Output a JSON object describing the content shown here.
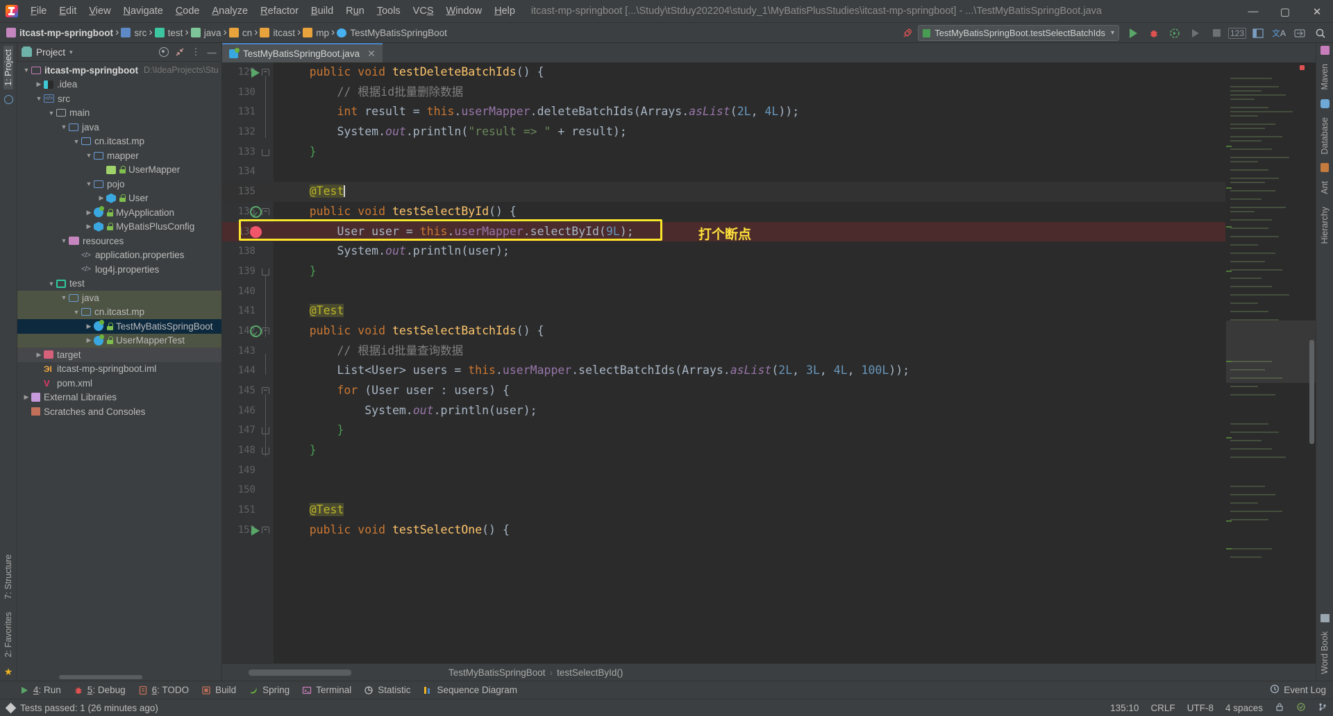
{
  "window": {
    "title": "itcast-mp-springboot [...\\Study\\tStduy202204\\study_1\\MyBatisPlusStudies\\itcast-mp-springboot] - ...\\TestMyBatisSpringBoot.java",
    "minimize": "—",
    "maximize": "▢",
    "close": "✕"
  },
  "menu": [
    {
      "label": "File"
    },
    {
      "label": "Edit"
    },
    {
      "label": "View"
    },
    {
      "label": "Navigate"
    },
    {
      "label": "Code"
    },
    {
      "label": "Analyze"
    },
    {
      "label": "Refactor"
    },
    {
      "label": "Build"
    },
    {
      "label": "Run"
    },
    {
      "label": "Tools"
    },
    {
      "label": "VCS"
    },
    {
      "label": "Window"
    },
    {
      "label": "Help"
    }
  ],
  "breadcrumb": [
    {
      "label": "itcast-mp-springboot",
      "icon": "module-icon"
    },
    {
      "label": "src",
      "icon": "source-root-icon"
    },
    {
      "label": "test",
      "icon": "test-root-icon"
    },
    {
      "label": "java",
      "icon": "folder-icon"
    },
    {
      "label": "cn",
      "icon": "package-icon"
    },
    {
      "label": "itcast",
      "icon": "package-icon"
    },
    {
      "label": "mp",
      "icon": "package-icon"
    },
    {
      "label": "TestMyBatisSpringBoot",
      "icon": "class-icon"
    }
  ],
  "run_config": {
    "label": "TestMyBatisSpringBoot.testSelectBatchIds",
    "dropdown": "▾"
  },
  "toolbar_right": {
    "run": "run-icon",
    "debug": "debug-icon",
    "run_coverage": "run-with-coverage-icon",
    "profile": "profile-icon",
    "stop": "stop-icon",
    "number": "123",
    "layout": "layout-icon",
    "translate": "translate-icon",
    "updates": "updates-icon",
    "search": "search-icon"
  },
  "left_rail": {
    "top": [
      "1: Project"
    ],
    "bottom": [
      "7: Structure",
      "2: Favorites"
    ]
  },
  "right_rail": {
    "top": [
      "Maven",
      "Database",
      "Ant",
      "Hierarchy"
    ],
    "bottom": [
      "Word Book"
    ]
  },
  "project_panel": {
    "title": "Project",
    "chevron": "▾",
    "actions": [
      "locate-icon",
      "collapse-all-icon",
      "options-icon",
      "hide-icon"
    ],
    "tree": [
      {
        "indent": 0,
        "arrow": "▼",
        "icon": "module-icon",
        "label": "itcast-mp-springboot",
        "bold": true,
        "path": "D:\\IdeaProjects\\Stu",
        "state": "normal"
      },
      {
        "indent": 1,
        "arrow": "▶",
        "icon": "idea-folder-icon",
        "label": ".idea",
        "state": "normal"
      },
      {
        "indent": 1,
        "arrow": "▼",
        "icon": "source-root-icon",
        "label": "src",
        "state": "normal"
      },
      {
        "indent": 2,
        "arrow": "▼",
        "icon": "folder-icon",
        "label": "main",
        "state": "normal"
      },
      {
        "indent": 3,
        "arrow": "▼",
        "icon": "folder-blue-icon",
        "label": "java",
        "state": "normal"
      },
      {
        "indent": 4,
        "arrow": "▼",
        "icon": "folder-blue-icon",
        "label": "cn.itcast.mp",
        "state": "normal"
      },
      {
        "indent": 5,
        "arrow": "▼",
        "icon": "folder-blue-icon",
        "label": "mapper",
        "state": "normal"
      },
      {
        "indent": 6,
        "arrow": "",
        "icon": "mapper-interface-icon",
        "label": "UserMapper",
        "lock": true,
        "state": "normal"
      },
      {
        "indent": 5,
        "arrow": "▼",
        "icon": "folder-blue-icon",
        "label": "pojo",
        "state": "normal"
      },
      {
        "indent": 6,
        "arrow": "▶",
        "icon": "class-icon",
        "label": "User",
        "lock": true,
        "state": "normal"
      },
      {
        "indent": 5,
        "arrow": "▶",
        "icon": "spring-class-icon",
        "label": "MyApplication",
        "lock": true,
        "state": "normal"
      },
      {
        "indent": 5,
        "arrow": "▶",
        "icon": "class-icon",
        "label": "MyBatisPlusConfig",
        "lock": true,
        "state": "normal"
      },
      {
        "indent": 3,
        "arrow": "▼",
        "icon": "resource-root-icon",
        "label": "resources",
        "state": "normal"
      },
      {
        "indent": 4,
        "arrow": "",
        "icon": "properties-icon",
        "label": "application.properties",
        "state": "normal"
      },
      {
        "indent": 4,
        "arrow": "",
        "icon": "properties-icon",
        "label": "log4j.properties",
        "state": "normal"
      },
      {
        "indent": 2,
        "arrow": "▼",
        "icon": "test-root-icon",
        "label": "test",
        "state": "normal"
      },
      {
        "indent": 3,
        "arrow": "▼",
        "icon": "folder-blue-icon",
        "label": "java",
        "state": "green"
      },
      {
        "indent": 4,
        "arrow": "▼",
        "icon": "folder-blue-icon",
        "label": "cn.itcast.mp",
        "state": "green"
      },
      {
        "indent": 5,
        "arrow": "▶",
        "icon": "spring-class-icon",
        "label": "TestMyBatisSpringBoot",
        "lock": true,
        "state": "selected"
      },
      {
        "indent": 5,
        "arrow": "▶",
        "icon": "spring-class-icon",
        "label": "UserMapperTest",
        "lock": true,
        "state": "green"
      },
      {
        "indent": 1,
        "arrow": "▶",
        "icon": "excluded-folder-icon",
        "label": "target",
        "state": "gray"
      },
      {
        "indent": 1,
        "arrow": "",
        "icon": "iml-icon",
        "label": "itcast-mp-springboot.iml",
        "state": "normal"
      },
      {
        "indent": 1,
        "arrow": "",
        "icon": "maven-icon",
        "label": "pom.xml",
        "state": "normal"
      },
      {
        "indent": 0,
        "arrow": "▶",
        "icon": "library-icon",
        "label": "External Libraries",
        "state": "normal"
      },
      {
        "indent": 0,
        "arrow": "",
        "icon": "scratches-icon",
        "label": "Scratches and Consoles",
        "state": "normal"
      }
    ]
  },
  "editor": {
    "tab": {
      "label": "TestMyBatisSpringBoot.java",
      "close": "✕",
      "icon": "java-spring-class-icon"
    },
    "first_line_number": 129,
    "lines": [
      {
        "n": 129,
        "marker": "run",
        "fold": "top",
        "html": "    <span class='kw'>public</span> <span class='kw'>void</span> <span class='fn'>testDeleteBatchIds</span><span class='brace'>()</span> <span class='brace'>{</span>",
        "text": "    public void testDeleteBatchIds() {"
      },
      {
        "n": 130,
        "marker": "",
        "fold": "",
        "html": "        <span class='cmt'>// 根据id批量删除数据</span>",
        "text": "        // 根据id批量删除数据"
      },
      {
        "n": 131,
        "marker": "",
        "fold": "",
        "html": "        <span class='kw'>int</span> result = <span class='kw'>this</span>.<span class='fld'>userMapper</span>.deleteBatchIds<span class='brace'>(</span>Arrays.<span class='fld'><i>asList</i></span><span class='brace'>(</span><span class='num'>2L</span>, <span class='num'>4L</span><span class='brace'>))</span>;",
        "text": "        int result = this.userMapper.deleteBatchIds(Arrays.asList(2L, 4L));"
      },
      {
        "n": 132,
        "marker": "",
        "fold": "",
        "html": "        System.<span class='fld'><i>out</i></span>.println<span class='brace'>(</span><span class='str'>\"result =&gt; \"</span> + result<span class='brace'>)</span>;",
        "text": "        System.out.println(\"result => \" + result);"
      },
      {
        "n": 133,
        "marker": "",
        "fold": "bot",
        "html": "    <span class='green-b'>}</span>",
        "text": "    }"
      },
      {
        "n": 134,
        "marker": "",
        "fold": "",
        "html": "",
        "text": ""
      },
      {
        "n": 135,
        "marker": "",
        "fold": "",
        "current": true,
        "html": "    <span class='ann ann-hl'>@Test</span><span class='caret'></span>",
        "text": "    @Test"
      },
      {
        "n": 136,
        "marker": "test-ok",
        "fold": "top",
        "html": "    <span class='kw'>public</span> <span class='kw'>void</span> <span class='fn'>testSelectById</span><span class='brace'>()</span> <span class='brace'>{</span>",
        "text": "    public void testSelectById() {"
      },
      {
        "n": 137,
        "marker": "breakpoint",
        "fold": "",
        "breakpoint": true,
        "html": "        User user = <span class='kw'>this</span>.<span class='fld'>userMapper</span>.selectById<span class='brace'>(</span><span class='num'>9L</span><span class='brace'>)</span>;",
        "text": "        User user = this.userMapper.selectById(9L);"
      },
      {
        "n": 138,
        "marker": "",
        "fold": "",
        "html": "        System.<span class='fld'><i>out</i></span>.println<span class='brace'>(</span>user<span class='brace'>)</span>;",
        "text": "        System.out.println(user);"
      },
      {
        "n": 139,
        "marker": "",
        "fold": "bot",
        "html": "    <span class='green-b'>}</span>",
        "text": "    }"
      },
      {
        "n": 140,
        "marker": "",
        "fold": "",
        "html": "",
        "text": ""
      },
      {
        "n": 141,
        "marker": "",
        "fold": "",
        "html": "    <span class='ann ann-hl'>@Test</span>",
        "text": "    @Test"
      },
      {
        "n": 142,
        "marker": "test-ok",
        "fold": "top",
        "html": "    <span class='kw'>public</span> <span class='kw'>void</span> <span class='fn'>testSelectBatchIds</span><span class='brace'>()</span> <span class='brace'>{</span>",
        "text": "    public void testSelectBatchIds() {"
      },
      {
        "n": 143,
        "marker": "",
        "fold": "",
        "html": "        <span class='cmt'>// 根据id批量查询数据</span>",
        "text": "        // 根据id批量查询数据"
      },
      {
        "n": 144,
        "marker": "",
        "fold": "",
        "html": "        List&lt;User&gt; users = <span class='kw'>this</span>.<span class='fld'>userMapper</span>.selectBatchIds<span class='brace'>(</span>Arrays.<span class='fld'><i>asList</i></span><span class='brace'>(</span><span class='num'>2L</span>, <span class='num'>3L</span>, <span class='num'>4L</span>, <span class='num'>100L</span><span class='brace'>))</span>;",
        "text": "        List<User> users = this.userMapper.selectBatchIds(Arrays.asList(2L, 3L, 4L, 100L));"
      },
      {
        "n": 145,
        "marker": "",
        "fold": "top",
        "html": "        <span class='kw'>for</span> <span class='brace'>(</span>User user : users<span class='brace'>)</span> <span class='brace'>{</span>",
        "text": "        for (User user : users) {"
      },
      {
        "n": 146,
        "marker": "",
        "fold": "",
        "html": "            System.<span class='fld'><i>out</i></span>.println<span class='brace'>(</span>user<span class='brace'>)</span>;",
        "text": "            System.out.println(user);"
      },
      {
        "n": 147,
        "marker": "",
        "fold": "bot",
        "html": "        <span class='green-b'>}</span>",
        "text": "        }"
      },
      {
        "n": 148,
        "marker": "",
        "fold": "bot",
        "html": "    <span class='green-b'>}</span>",
        "text": "    }"
      },
      {
        "n": 149,
        "marker": "",
        "fold": "",
        "html": "",
        "text": ""
      },
      {
        "n": 150,
        "marker": "",
        "fold": "",
        "html": "",
        "text": ""
      },
      {
        "n": 151,
        "marker": "",
        "fold": "",
        "html": "    <span class='ann ann-hl'>@Test</span>",
        "text": "    @Test"
      },
      {
        "n": 152,
        "marker": "run",
        "fold": "top",
        "html": "    <span class='kw'>public</span> <span class='kw'>void</span> <span class='fn'>testSelectOne</span><span class='brace'>()</span> <span class='brace'>{</span>",
        "text": "    public void testSelectOne() {"
      }
    ],
    "annotation": {
      "text": "打个断点",
      "color": "#ffe13b",
      "box_color": "#fbe52b"
    }
  },
  "editor_breadcrumb": [
    {
      "label": "TestMyBatisSpringBoot"
    },
    {
      "label": "testSelectById()"
    }
  ],
  "tool_windows": [
    {
      "num": "4",
      "label": ": Run",
      "icon": "run-icon"
    },
    {
      "num": "5",
      "label": ": Debug",
      "icon": "debug-icon"
    },
    {
      "num": "6",
      "label": ": TODO",
      "icon": "todo-icon"
    },
    {
      "num": "",
      "label": "Build",
      "icon": "build-icon"
    },
    {
      "num": "",
      "label": "Spring",
      "icon": "spring-icon"
    },
    {
      "num": "",
      "label": "Terminal",
      "icon": "terminal-icon"
    },
    {
      "num": "",
      "label": "Statistic",
      "icon": "statistic-icon"
    },
    {
      "num": "",
      "label": "Sequence Diagram",
      "icon": "sequence-diagram-icon"
    }
  ],
  "event_log": {
    "label": "Event Log",
    "icon": "event-log-icon"
  },
  "status": {
    "message": "Tests passed: 1 (26 minutes ago)",
    "caret": "135:10",
    "line_separator": "CRLF",
    "encoding": "UTF-8",
    "indent": "4 spaces",
    "lock": "read-only-icon",
    "analyze": "inspection-icon",
    "branch": "git-branch-icon"
  },
  "colors": {
    "accent_blue": "#4a88c7",
    "breakpoint_red": "#f2566a",
    "annotation_yellow": "#fbe52b",
    "editor_bg": "#2b2b2b",
    "panel_bg": "#3c3f41",
    "selection_blue": "#0d293e",
    "test_green": "#59a869"
  }
}
